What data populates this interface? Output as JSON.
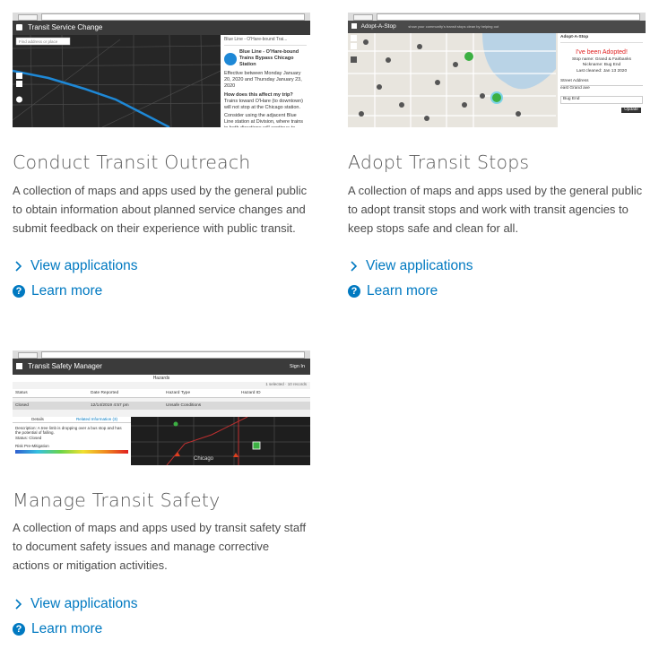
{
  "cards": [
    {
      "title": "Conduct Transit Outreach",
      "description": "A collection of maps and apps used by the general public to obtain information about planned service changes and submit feedback on their experience with public transit.",
      "view_label": "View applications",
      "learn_label": "Learn more",
      "thumb": {
        "app_title": "Transit Service Change",
        "search_placeholder": "Find address or place",
        "panel_header": "Blue Line - O'Hare-bound Trai...",
        "panel_title": "Blue Line - O'Hare-bound Trains Bypass Chicago Station",
        "panel_dates": "Effective between Monday January 20, 2020 and Thursday January 23, 2020",
        "panel_question": "How does this affect my trip?",
        "panel_text": "Trains toward O'Hare (to downtown) will not stop at the Chicago station.",
        "panel_text2": "Consider using the adjacent Blue Line station at Division, where trains in both directions will continue to stop."
      }
    },
    {
      "title": "Adopt Transit Stops",
      "description": "A collection of maps and apps used by the general public to adopt transit stops and work with transit agencies to keep stops safe and clean for all.",
      "view_label": "View applications",
      "learn_label": "Learn more",
      "thumb": {
        "app_title": "Adopt-A-Stop",
        "tagline": "show your community's transit stops clean by helping out",
        "panel_header": "Adopt-A-Stop",
        "adopted": "I've been Adopted!",
        "stop_name": "Stop name: Grand & Fairbanks",
        "nickname": "Nickname: Bug End",
        "last_cleaned": "Last cleaned: Jan 13 2020",
        "field1": "Street Address",
        "field2": "east Grand ave",
        "field3": "Bug End",
        "update_label": "Update"
      }
    },
    {
      "title": "Manage Transit Safety",
      "description": "A collection of maps and apps used by transit safety staff to document safety issues and manage corrective actions or mitigation activities.",
      "view_label": "View applications",
      "learn_label": "Learn more",
      "thumb": {
        "app_title": "Transit Safety Manager",
        "sign_in": "Sign In",
        "tab_label": "Hazards",
        "selected_text": "1 selected · 10 records",
        "columns": [
          "Status",
          "Date Reported",
          "Hazard Type",
          "Hazard ID"
        ],
        "row": [
          "Closed",
          "12/14/2019 4:57 pm",
          "Unsafe Conditions",
          ""
        ],
        "tab_details": "Details",
        "tab_related": "Related Information (3)",
        "detail_text": "Description: A tree limb is dropping over a bus stop and has the potential of falling.",
        "detail_status": "Status: Closed",
        "risk_label": "Risk Pre-Mitigation",
        "map_label": "Chicago"
      }
    }
  ]
}
